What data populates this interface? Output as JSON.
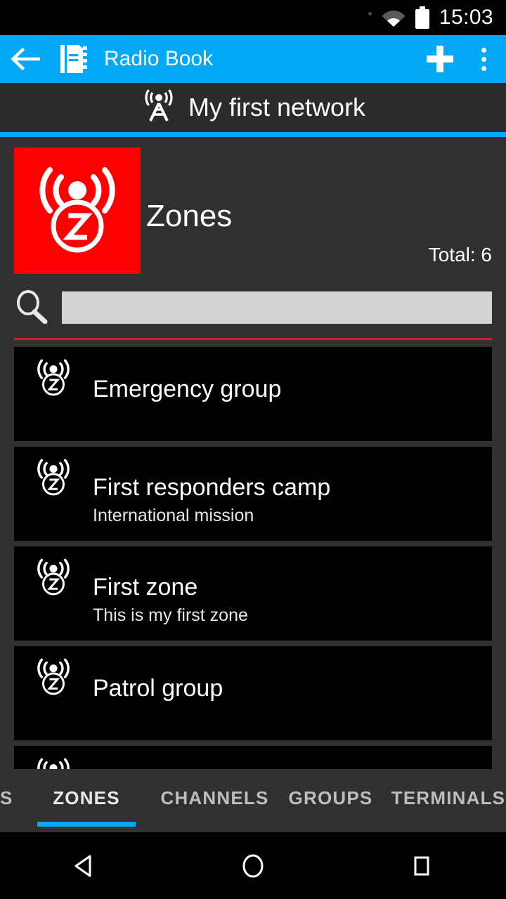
{
  "status_bar": {
    "time": "15:03",
    "wifi_icon": "wifi-icon",
    "battery_icon": "battery-icon"
  },
  "app_bar": {
    "back_icon": "back-arrow-icon",
    "book_icon": "radio-book-icon",
    "title": "Radio Book",
    "add_icon": "plus-icon",
    "overflow_icon": "overflow-menu-icon"
  },
  "network_header": {
    "tower_icon": "radio-tower-icon",
    "name": "My first network",
    "accent_color": "#03A9F4"
  },
  "hero": {
    "tile_icon": "zone-radio-icon",
    "tile_color": "#FF0000",
    "title": "Zones",
    "total_label": "Total: 6"
  },
  "search": {
    "icon": "magnifier-icon",
    "value": "",
    "placeholder": "",
    "divider_color": "#D32020"
  },
  "list": {
    "items": [
      {
        "icon": "zone-radio-icon",
        "title": "Emergency group",
        "subtitle": ""
      },
      {
        "icon": "zone-radio-icon",
        "title": "First responders camp",
        "subtitle": "International mission"
      },
      {
        "icon": "zone-radio-icon",
        "title": "First zone",
        "subtitle": "This is my first zone"
      },
      {
        "icon": "zone-radio-icon",
        "title": "Patrol group",
        "subtitle": ""
      },
      {
        "icon": "zone-radio-icon",
        "title": "",
        "subtitle": ""
      }
    ]
  },
  "tabs": {
    "active_index": 1,
    "active_color": "#03A9F4",
    "items": [
      {
        "label": "S"
      },
      {
        "label": "ZONES"
      },
      {
        "label": "CHANNELS"
      },
      {
        "label": "GROUPS"
      },
      {
        "label": "TERMINALS"
      }
    ]
  },
  "nav_bar": {
    "back_icon": "nav-back-triangle-icon",
    "home_icon": "nav-home-circle-icon",
    "recents_icon": "nav-recents-square-icon"
  }
}
